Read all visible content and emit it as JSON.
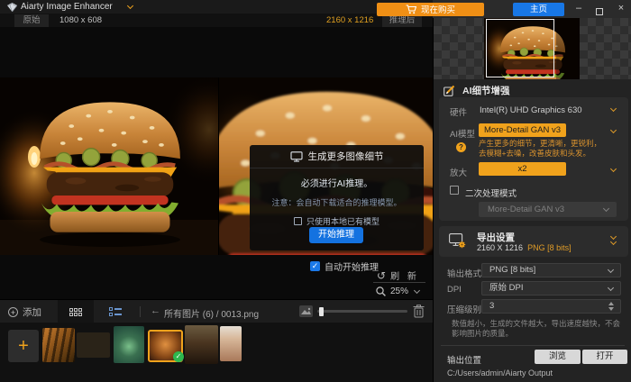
{
  "window": {
    "title": "Aiarty Image Enhancer",
    "minimize_glyph": "–",
    "close_glyph": "×"
  },
  "titlebar": {
    "buy_label": "现在购买",
    "home_label": "主页"
  },
  "viewbar": {
    "original_tab": "原始",
    "original_size": "1080 x 608",
    "result_size": "2160 x 1216",
    "result_tab": "推理后"
  },
  "dialog": {
    "title": "生成更多图像细节",
    "subtitle": "必须进行AI推理。",
    "note": "注意：会自动下载适合的推理模型。",
    "local_only_label": "只使用本地已有模型",
    "start_label": "开始推理"
  },
  "canvas_controls": {
    "auto_start_label": "自动开始推理",
    "auto_start_check": "✓",
    "refresh_icon": "↺",
    "refresh_label": "刷 新",
    "zoom_level": "25%"
  },
  "panel": {
    "ai_section_title": "AI细节增强",
    "hardware": {
      "label": "硬件",
      "value": "Intel(R) UHD Graphics 630"
    },
    "model": {
      "label": "AI模型",
      "value": "More-Detail GAN  v3",
      "help_q": "?",
      "help_line1": "产生更多的细节，更清晰，更锐利，",
      "help_line2": "去模糊+去噪，改善皮肤和头发。"
    },
    "scale": {
      "label": "放大",
      "value": "x2"
    },
    "second_pass": {
      "label": "二次处理模式",
      "model_value": "More-Detail GAN  v3"
    },
    "export": {
      "title": "导出设置",
      "summary_size": "2160 X 1216",
      "summary_format": "PNG  [8 bits]",
      "format": {
        "label": "输出格式",
        "value": "PNG  [8 bits]"
      },
      "dpi": {
        "label": "DPI",
        "value": "原始 DPI"
      },
      "compression": {
        "label": "压缩级别",
        "value": "3"
      },
      "hint_line1": "数值越小，生成的文件越大，导出速度越快，不会",
      "hint_line2": "影响图片的质量。",
      "output": {
        "label": "输出位置",
        "browse_label": "浏览",
        "open_label": "打开",
        "path": "C:/Users/admin/Aiarty Output"
      }
    }
  },
  "bottombar": {
    "add_label": "添加",
    "add_plus": "+",
    "back_arrow": "←",
    "breadcrumb": "所有图片 (6) / 0013.png"
  },
  "thumbnails": {
    "add_plus": "+",
    "selected_check": "✓",
    "items": [
      "tiger",
      "butterfly",
      "terrarium",
      "burger",
      "dog",
      "portrait"
    ],
    "selected": "burger"
  },
  "colors": {
    "accent_orange": "#F0A21C",
    "buy_orange": "#EF8F15",
    "home_blue": "#1877E6",
    "start_blue": "#1472E0",
    "check_green": "#2EB84E",
    "help_orange": "#D8922E"
  }
}
